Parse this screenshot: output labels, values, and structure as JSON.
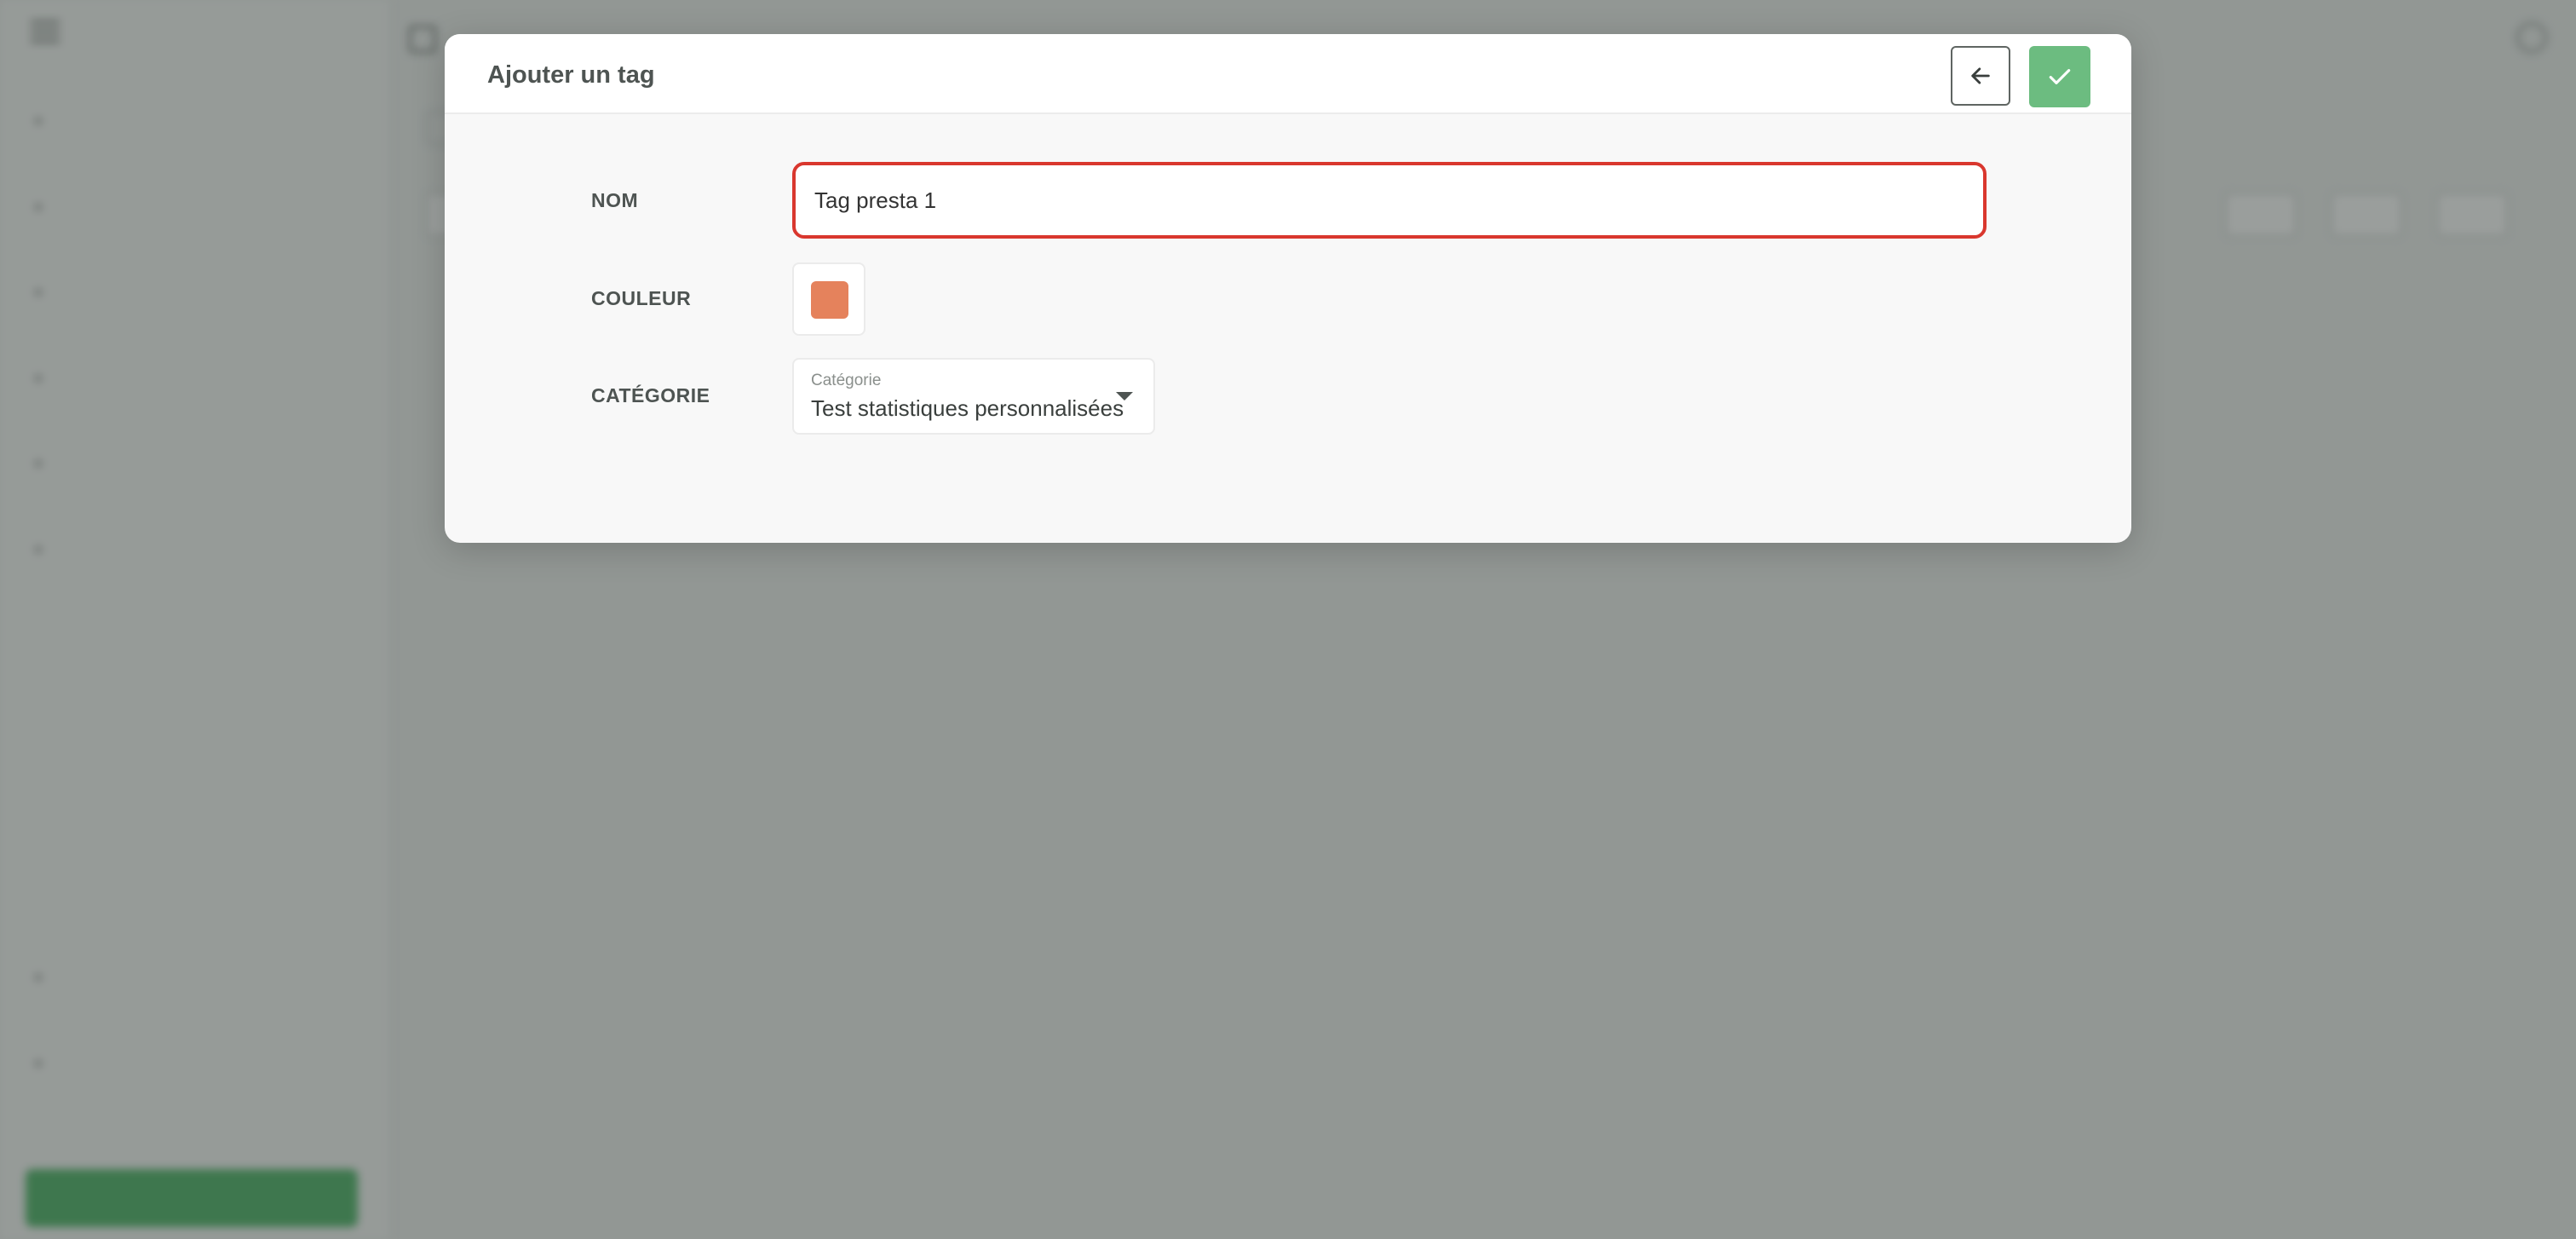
{
  "modal": {
    "title": "Ajouter un tag",
    "back_icon": "arrow-left-icon",
    "confirm_icon": "check-icon",
    "confirm_color": "#6cbc80",
    "fields": {
      "name": {
        "label": "NOM",
        "value": "Tag presta 1",
        "error_border_color": "#d9372e"
      },
      "color": {
        "label": "COULEUR",
        "value": "#e5825c"
      },
      "category": {
        "label": "CATÉGORIE",
        "caption": "Catégorie",
        "selected": "Test statistiques personnalisées",
        "caret_icon": "caret-down-icon"
      }
    }
  }
}
